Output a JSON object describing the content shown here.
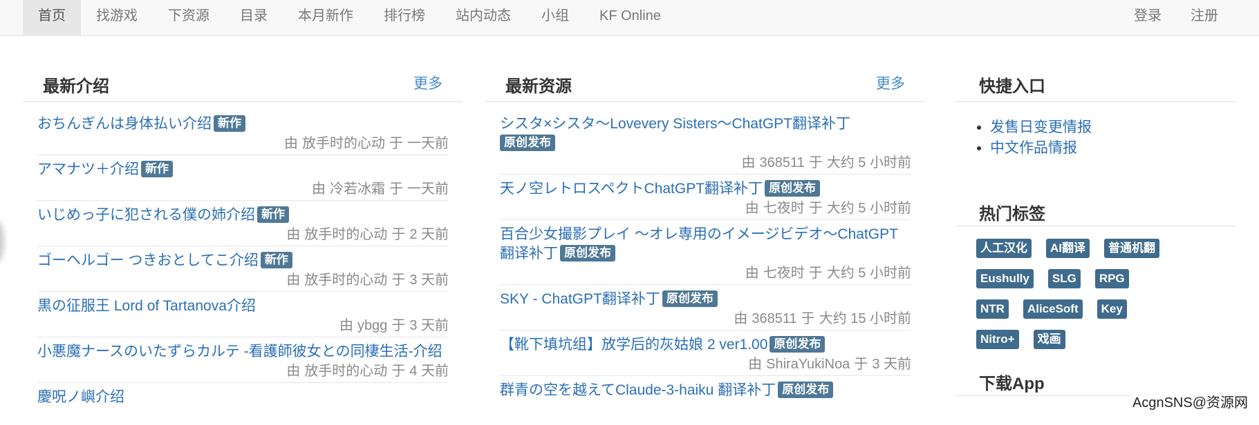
{
  "nav": {
    "left": [
      "首页",
      "找游戏",
      "下资源",
      "目录",
      "本月新作",
      "排行榜",
      "站内动态",
      "小组",
      "KF Online"
    ],
    "right": [
      "登录",
      "注册"
    ]
  },
  "intro": {
    "title": "最新介绍",
    "more": "更多",
    "items": [
      {
        "title": "おちんぎんは身体払い介绍",
        "badge": "新作",
        "by": "由",
        "author": "放手时的心动",
        "at": "于",
        "time": "一天前"
      },
      {
        "title": "アマナツ＋介绍",
        "badge": "新作",
        "by": "由",
        "author": "冷若冰霜",
        "at": "于",
        "time": "一天前"
      },
      {
        "title": "いじめっ子に犯される僕の姉介绍",
        "badge": "新作",
        "by": "由",
        "author": "放手时的心动",
        "at": "于",
        "time": "2 天前"
      },
      {
        "title": "ゴーヘルゴー つきおとしてこ介绍",
        "badge": "新作",
        "by": "由",
        "author": "放手时的心动",
        "at": "于",
        "time": "3 天前"
      },
      {
        "title": "黒の征服王 Lord of Tartanova介绍",
        "badge": "",
        "by": "由",
        "author": "ybgg",
        "at": "于",
        "time": "3 天前"
      },
      {
        "title": "小悪魔ナースのいたずらカルテ -看護師彼女との同棲生活-介绍",
        "badge": "",
        "by": "由",
        "author": "放手时的心动",
        "at": "于",
        "time": "4 天前"
      },
      {
        "title": "慶呪ノ嶼介绍",
        "badge": "",
        "by": "",
        "author": "",
        "at": "",
        "time": ""
      }
    ]
  },
  "resources": {
    "title": "最新资源",
    "more": "更多",
    "items": [
      {
        "title": "シスタ×シスタ～Lovevery Sisters～ChatGPT翻译补丁",
        "badge": "原创发布",
        "by": "由",
        "author": "368511",
        "at": "于",
        "time": "大约 5 小时前"
      },
      {
        "title": "天ノ空レトロスペクトChatGPT翻译补丁",
        "badge": "原创发布",
        "by": "由",
        "author": "七夜时",
        "at": "于",
        "time": "大约 5 小时前"
      },
      {
        "title": "百合少女撮影プレイ ～オレ専用のイメージビデオ～ChatGPT翻译补丁",
        "badge": "原创发布",
        "by": "由",
        "author": "七夜时",
        "at": "于",
        "time": "大约 5 小时前"
      },
      {
        "title": "SKY - ChatGPT翻译补丁",
        "badge": "原创发布",
        "by": "由",
        "author": "368511",
        "at": "于",
        "time": "大约 15 小时前"
      },
      {
        "title": "【靴下填坑组】放学后的灰姑娘 2 ver1.00",
        "badge": "原创发布",
        "by": "由",
        "author": "ShiraYukiNoa",
        "at": "于",
        "time": "3 天前"
      },
      {
        "title": "群青の空を越えてClaude-3-haiku 翻译补丁",
        "badge": "原创发布",
        "by": "",
        "author": "",
        "at": "",
        "time": ""
      }
    ]
  },
  "quick": {
    "title": "快捷入口",
    "links": [
      "发售日变更情报",
      "中文作品情报"
    ]
  },
  "tags": {
    "title": "热门标签",
    "items": [
      "人工汉化",
      "AI翻译",
      "普通机翻",
      "Eushully",
      "SLG",
      "RPG",
      "NTR",
      "AliceSoft",
      "Key",
      "Nitro+",
      "戏画"
    ]
  },
  "app": {
    "title": "下载App"
  },
  "watermark": "AcgnSNS@资源网"
}
